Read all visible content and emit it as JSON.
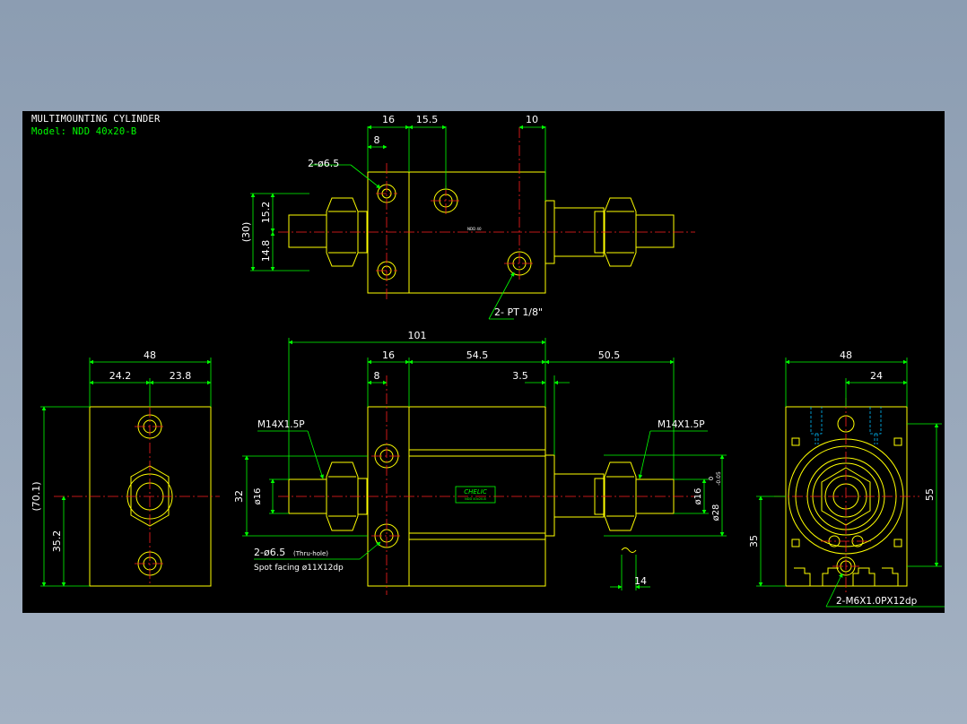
{
  "title_block": {
    "title": "MULTIMOUNTING CYLINDER",
    "model": "Model: NDD 40x20-B"
  },
  "colors": {
    "background": "#000000",
    "outline": "#ffff00",
    "dimension": "#00ff00",
    "centerline": "#ff2020",
    "hidden": "#00bfff",
    "text": "#ffffff",
    "desktop": "#8fa0b5"
  },
  "top_view": {
    "dims": {
      "d16": "16",
      "d15_5": "15.5",
      "d10": "10",
      "d8": "8",
      "d15_2": "15.2",
      "d14_8": "14.8",
      "d30": "(30)"
    },
    "callout_holes": "2-ø6.5",
    "callout_port": "2- PT 1/8\"",
    "tiny_mark": "NDD 40"
  },
  "front_view": {
    "dims": {
      "d101": "101",
      "d16": "16",
      "d54_5": "54.5",
      "d50_5": "50.5",
      "d8": "8",
      "d3_5": "3.5",
      "d32": "32",
      "d14": "14",
      "dia16_left": "ø16",
      "dia16_right": "ø16",
      "dia28": "ø28",
      "tol_upper": "0",
      "tol_lower": "-0.05"
    },
    "thread_left": "M14X1.5P",
    "thread_right": "M14X1.5P",
    "hole_callout_1": "2-ø6.5",
    "hole_callout_1_note": "(Thru-hole)",
    "hole_callout_2": "Spot facing  ø11X12dp",
    "brand_label": "CHELIC",
    "brand_sub": "NDD 40x20-B"
  },
  "left_view": {
    "dims": {
      "d48": "48",
      "d24_2": "24.2",
      "d23_8": "23.8",
      "d70_1": "(70.1)",
      "d35_2": "35.2"
    }
  },
  "right_view": {
    "dims": {
      "d48": "48",
      "d24": "24",
      "d55": "55",
      "d35": "35"
    },
    "callout": "2-M6X1.0PX12dp"
  }
}
